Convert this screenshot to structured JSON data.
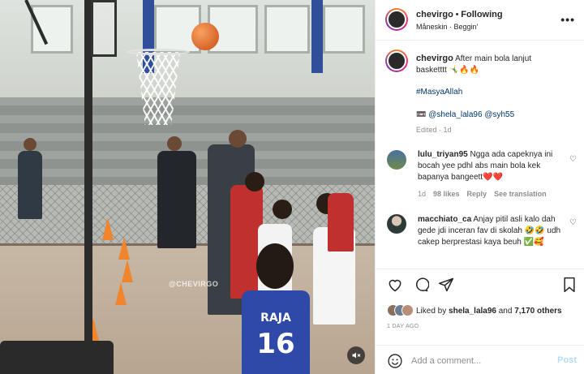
{
  "media": {
    "watermark": "@CHEVIRGO",
    "jersey_name": "RAJA",
    "jersey_number": "16"
  },
  "header": {
    "username": "chevirgo",
    "separator": "•",
    "follow_status": "Following",
    "audio": "Måneskin · Beggin'"
  },
  "caption": {
    "username": "chevirgo",
    "text_line1": "After main bola lanjut",
    "text_line2": "basketttt 🤸‍♂️🔥🔥",
    "hashtag": "#MasyaAllah",
    "tag_prefix": "📼",
    "tag1": "@shela_lala96",
    "tag2": "@syh55",
    "edited": "Edited · 1d"
  },
  "comments": [
    {
      "username": "lulu_triyan95",
      "text": "Ngga ada capeknya ini bocah yee pdhl abs main bola kek bapanya bangeett❤️❤️",
      "time": "1d",
      "likes": "98 likes",
      "reply": "Reply",
      "translation": "See translation"
    },
    {
      "username": "macchiato_ca",
      "text": "Anjay pitil asli kalo dah gede jdi inceran fav di skolah 🤣🤣 udh cakep berprestasi kaya beuh ✅🥰"
    }
  ],
  "likes": {
    "prefix": "Liked by",
    "user": "shela_lala96",
    "and": "and",
    "count": "7,170 others"
  },
  "timestamp": "1 DAY AGO",
  "add_comment": {
    "placeholder": "Add a comment...",
    "post_label": "Post"
  }
}
